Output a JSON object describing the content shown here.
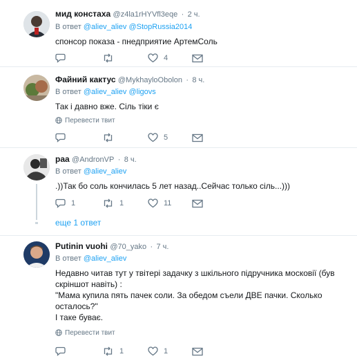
{
  "tweets": [
    {
      "name": "мид констаха",
      "handle": "@z4la1rHYVfl3eqe",
      "time": "2 ч.",
      "reply_prefix": "В ответ",
      "reply_to": [
        "@aliev_aliev",
        "@StopRussia2014"
      ],
      "lines": [
        "спонсор показа - пнедприятие АртемСоль"
      ],
      "replies": "",
      "retweets": "",
      "likes": "4"
    },
    {
      "name": "Файний кактус",
      "handle": "@MykhayloObolon",
      "time": "8 ч.",
      "reply_prefix": "В ответ",
      "reply_to": [
        "@aliev_aliev",
        "@ligovs"
      ],
      "lines": [
        "Так і давно вже. Сіль тіки є"
      ],
      "translate": "Перевести твит",
      "replies": "",
      "retweets": "",
      "likes": "5"
    },
    {
      "name": "раа",
      "handle": "@AndronVP",
      "time": "8 ч.",
      "reply_prefix": "В ответ",
      "reply_to": [
        "@aliev_aliev"
      ],
      "lines": [
        ".))Так бо соль кончилась 5 лет назад..Сейчас только сіль...)))"
      ],
      "replies": "1",
      "retweets": "1",
      "likes": "11",
      "more_replies": "еще 1 ответ"
    },
    {
      "name": "Putinin vuohi",
      "handle": "@70_yako",
      "time": "7 ч.",
      "reply_prefix": "В ответ",
      "reply_to": [
        "@aliev_aliev"
      ],
      "lines": [
        "Недавно читав тут у твітері задачку з шкільного підручника московії (був",
        "скріншот навіть) :",
        "\"Мама купила пять пачек соли. За обедом съели ДВЕ пачки. Сколько",
        "осталось?\"",
        "І таке буває."
      ],
      "translate": "Перевести твит",
      "replies": "",
      "retweets": "1",
      "likes": "1"
    }
  ],
  "colors": {
    "link": "#1da1f2",
    "muted": "#657786",
    "divider": "#e6ecf0"
  }
}
